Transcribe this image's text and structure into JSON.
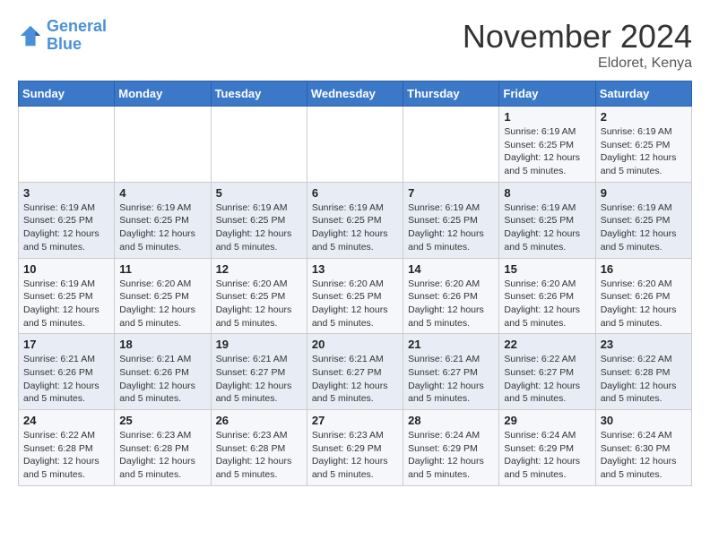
{
  "logo": {
    "line1": "General",
    "line2": "Blue"
  },
  "title": "November 2024",
  "location": "Eldoret, Kenya",
  "weekdays": [
    "Sunday",
    "Monday",
    "Tuesday",
    "Wednesday",
    "Thursday",
    "Friday",
    "Saturday"
  ],
  "weeks": [
    [
      {
        "day": "",
        "info": ""
      },
      {
        "day": "",
        "info": ""
      },
      {
        "day": "",
        "info": ""
      },
      {
        "day": "",
        "info": ""
      },
      {
        "day": "",
        "info": ""
      },
      {
        "day": "1",
        "info": "Sunrise: 6:19 AM\nSunset: 6:25 PM\nDaylight: 12 hours\nand 5 minutes."
      },
      {
        "day": "2",
        "info": "Sunrise: 6:19 AM\nSunset: 6:25 PM\nDaylight: 12 hours\nand 5 minutes."
      }
    ],
    [
      {
        "day": "3",
        "info": "Sunrise: 6:19 AM\nSunset: 6:25 PM\nDaylight: 12 hours\nand 5 minutes."
      },
      {
        "day": "4",
        "info": "Sunrise: 6:19 AM\nSunset: 6:25 PM\nDaylight: 12 hours\nand 5 minutes."
      },
      {
        "day": "5",
        "info": "Sunrise: 6:19 AM\nSunset: 6:25 PM\nDaylight: 12 hours\nand 5 minutes."
      },
      {
        "day": "6",
        "info": "Sunrise: 6:19 AM\nSunset: 6:25 PM\nDaylight: 12 hours\nand 5 minutes."
      },
      {
        "day": "7",
        "info": "Sunrise: 6:19 AM\nSunset: 6:25 PM\nDaylight: 12 hours\nand 5 minutes."
      },
      {
        "day": "8",
        "info": "Sunrise: 6:19 AM\nSunset: 6:25 PM\nDaylight: 12 hours\nand 5 minutes."
      },
      {
        "day": "9",
        "info": "Sunrise: 6:19 AM\nSunset: 6:25 PM\nDaylight: 12 hours\nand 5 minutes."
      }
    ],
    [
      {
        "day": "10",
        "info": "Sunrise: 6:19 AM\nSunset: 6:25 PM\nDaylight: 12 hours\nand 5 minutes."
      },
      {
        "day": "11",
        "info": "Sunrise: 6:20 AM\nSunset: 6:25 PM\nDaylight: 12 hours\nand 5 minutes."
      },
      {
        "day": "12",
        "info": "Sunrise: 6:20 AM\nSunset: 6:25 PM\nDaylight: 12 hours\nand 5 minutes."
      },
      {
        "day": "13",
        "info": "Sunrise: 6:20 AM\nSunset: 6:25 PM\nDaylight: 12 hours\nand 5 minutes."
      },
      {
        "day": "14",
        "info": "Sunrise: 6:20 AM\nSunset: 6:26 PM\nDaylight: 12 hours\nand 5 minutes."
      },
      {
        "day": "15",
        "info": "Sunrise: 6:20 AM\nSunset: 6:26 PM\nDaylight: 12 hours\nand 5 minutes."
      },
      {
        "day": "16",
        "info": "Sunrise: 6:20 AM\nSunset: 6:26 PM\nDaylight: 12 hours\nand 5 minutes."
      }
    ],
    [
      {
        "day": "17",
        "info": "Sunrise: 6:21 AM\nSunset: 6:26 PM\nDaylight: 12 hours\nand 5 minutes."
      },
      {
        "day": "18",
        "info": "Sunrise: 6:21 AM\nSunset: 6:26 PM\nDaylight: 12 hours\nand 5 minutes."
      },
      {
        "day": "19",
        "info": "Sunrise: 6:21 AM\nSunset: 6:27 PM\nDaylight: 12 hours\nand 5 minutes."
      },
      {
        "day": "20",
        "info": "Sunrise: 6:21 AM\nSunset: 6:27 PM\nDaylight: 12 hours\nand 5 minutes."
      },
      {
        "day": "21",
        "info": "Sunrise: 6:21 AM\nSunset: 6:27 PM\nDaylight: 12 hours\nand 5 minutes."
      },
      {
        "day": "22",
        "info": "Sunrise: 6:22 AM\nSunset: 6:27 PM\nDaylight: 12 hours\nand 5 minutes."
      },
      {
        "day": "23",
        "info": "Sunrise: 6:22 AM\nSunset: 6:28 PM\nDaylight: 12 hours\nand 5 minutes."
      }
    ],
    [
      {
        "day": "24",
        "info": "Sunrise: 6:22 AM\nSunset: 6:28 PM\nDaylight: 12 hours\nand 5 minutes."
      },
      {
        "day": "25",
        "info": "Sunrise: 6:23 AM\nSunset: 6:28 PM\nDaylight: 12 hours\nand 5 minutes."
      },
      {
        "day": "26",
        "info": "Sunrise: 6:23 AM\nSunset: 6:28 PM\nDaylight: 12 hours\nand 5 minutes."
      },
      {
        "day": "27",
        "info": "Sunrise: 6:23 AM\nSunset: 6:29 PM\nDaylight: 12 hours\nand 5 minutes."
      },
      {
        "day": "28",
        "info": "Sunrise: 6:24 AM\nSunset: 6:29 PM\nDaylight: 12 hours\nand 5 minutes."
      },
      {
        "day": "29",
        "info": "Sunrise: 6:24 AM\nSunset: 6:29 PM\nDaylight: 12 hours\nand 5 minutes."
      },
      {
        "day": "30",
        "info": "Sunrise: 6:24 AM\nSunset: 6:30 PM\nDaylight: 12 hours\nand 5 minutes."
      }
    ]
  ]
}
